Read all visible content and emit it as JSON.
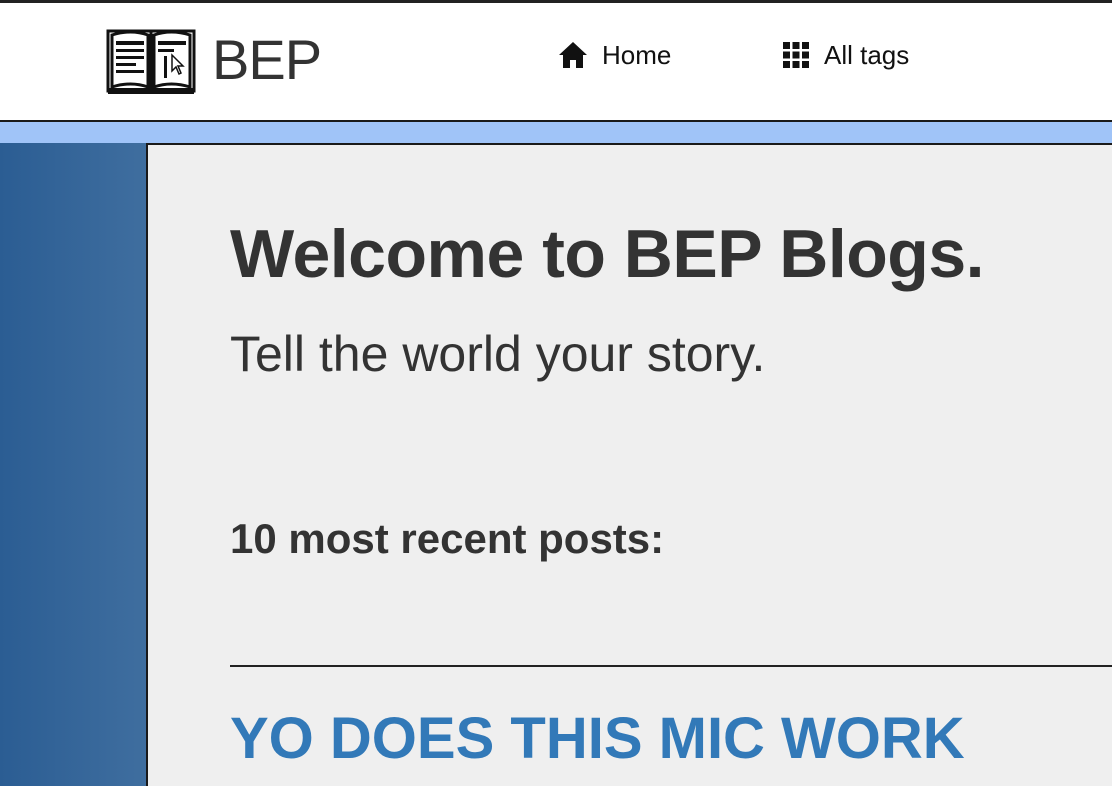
{
  "header": {
    "brand": "BEP",
    "brand_logo_icon": "open-book-with-cursor-icon",
    "nav": {
      "home_label": "Home",
      "home_icon": "home-icon",
      "tags_label": "All tags",
      "tags_icon": "grid-icon"
    }
  },
  "main": {
    "welcome_title": "Welcome to BEP Blogs.",
    "tagline": "Tell the world your story.",
    "recent_heading": "10 most recent posts:",
    "posts": [
      {
        "title": "YO DOES THIS MIC WORK"
      }
    ]
  },
  "colors": {
    "accent_band": "#a0c4f8",
    "sidebar": "#2b5d93",
    "content_bg": "#efefef",
    "post_link": "#3279b8",
    "text": "#333333"
  }
}
